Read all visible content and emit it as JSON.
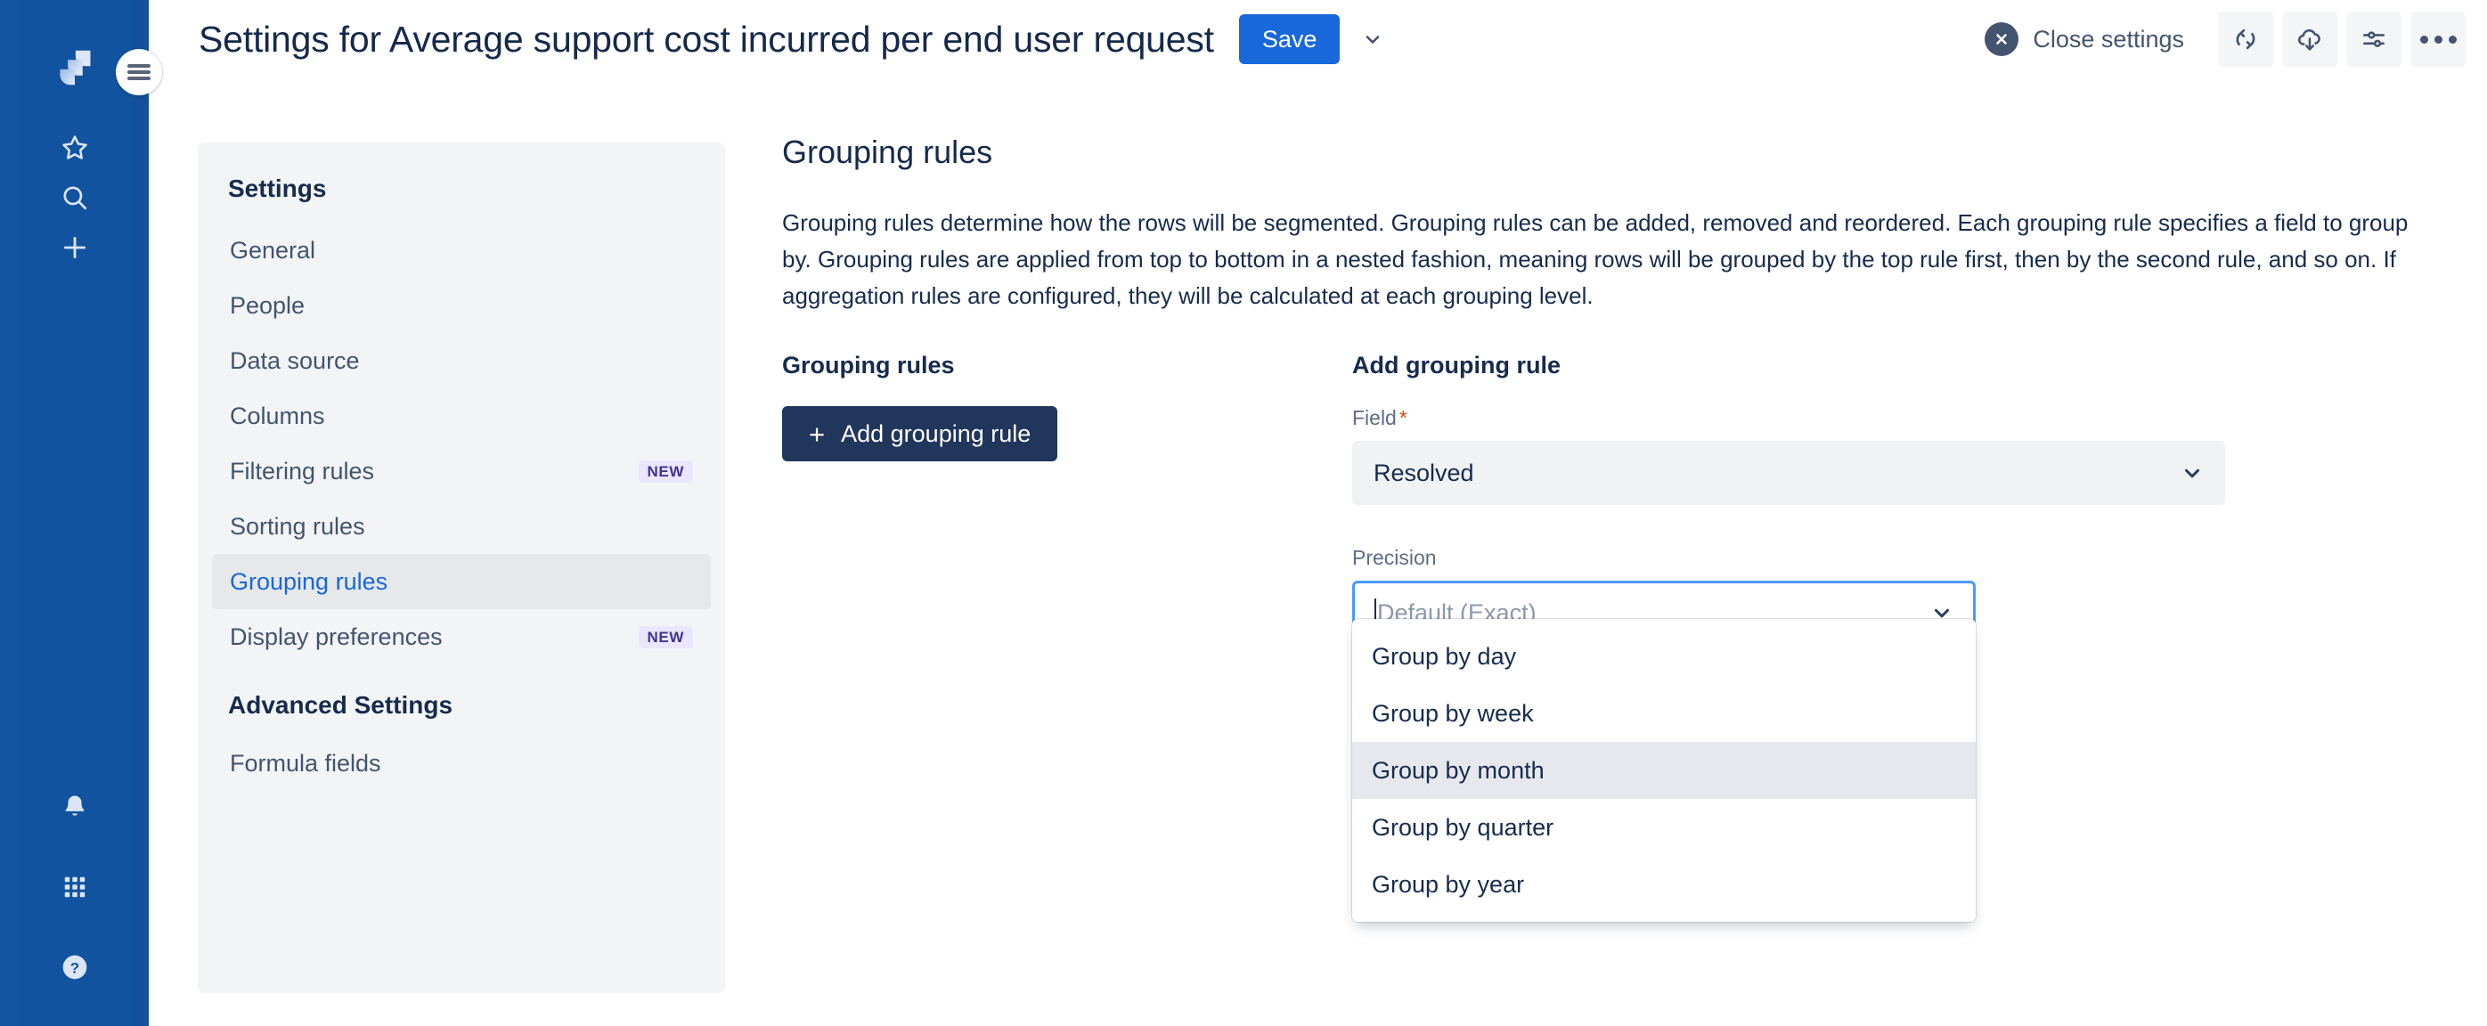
{
  "app_nav": {
    "logo_name": "jira-logo",
    "items": [
      {
        "name": "starred-icon",
        "label": "Starred"
      },
      {
        "name": "search-icon",
        "label": "Search"
      },
      {
        "name": "create-icon",
        "label": "Create"
      }
    ],
    "bottom_items": [
      {
        "name": "notifications-bell-icon",
        "label": "Notifications"
      },
      {
        "name": "app-switcher-icon",
        "label": "App switcher"
      },
      {
        "name": "help-icon",
        "label": "Help"
      }
    ]
  },
  "header": {
    "menu_toggle_name": "hamburger-menu",
    "title": "Settings for Average support cost incurred per end user request",
    "save_label": "Save",
    "save_caret_name": "save-options-chevron",
    "close_settings_label": "Close settings",
    "actions": [
      {
        "name": "sync-icon",
        "label": "Sync"
      },
      {
        "name": "cloud-download-icon",
        "label": "Export"
      },
      {
        "name": "sliders-icon",
        "label": "Configure"
      },
      {
        "name": "more-actions-icon",
        "label": "More actions"
      }
    ]
  },
  "settings_panel": {
    "heading": "Settings",
    "items": [
      {
        "label": "General",
        "badge": "",
        "active": false
      },
      {
        "label": "People",
        "badge": "",
        "active": false
      },
      {
        "label": "Data source",
        "badge": "",
        "active": false
      },
      {
        "label": "Columns",
        "badge": "",
        "active": false
      },
      {
        "label": "Filtering rules",
        "badge": "NEW",
        "active": false
      },
      {
        "label": "Sorting rules",
        "badge": "",
        "active": false
      },
      {
        "label": "Grouping rules",
        "badge": "",
        "active": true
      },
      {
        "label": "Display preferences",
        "badge": "NEW",
        "active": false
      }
    ],
    "advanced_heading": "Advanced Settings",
    "advanced_items": [
      {
        "label": "Formula fields",
        "badge": "",
        "active": false
      }
    ]
  },
  "main": {
    "title": "Grouping rules",
    "description": "Grouping rules determine how the rows will be segmented. Grouping rules can be added, removed and reordered. Each grouping rule specifies a field to group by. Grouping rules are applied from top to bottom in a nested fashion, meaning rows will be grouped by the top rule first, then by the second rule, and so on. If aggregation rules are configured, they will be calculated at each grouping level.",
    "left_column": {
      "title": "Grouping rules",
      "add_button_label": "Add grouping rule",
      "add_button_icon": "plus-icon"
    },
    "right_column": {
      "title": "Add grouping rule",
      "field": {
        "label": "Field",
        "required_marker": "*",
        "value": "Resolved",
        "chevron_name": "chevron-down-icon"
      },
      "precision": {
        "label": "Precision",
        "placeholder": "Default (Exact)",
        "value": "",
        "chevron_name": "chevron-down-icon",
        "options": [
          {
            "label": "Group by day",
            "hovered": false
          },
          {
            "label": "Group by week",
            "hovered": false
          },
          {
            "label": "Group by month",
            "hovered": true
          },
          {
            "label": "Group by quarter",
            "hovered": false
          },
          {
            "label": "Group by year",
            "hovered": false
          }
        ]
      }
    }
  },
  "colors": {
    "nav_blue": "#1253a0",
    "primary_blue": "#1868db",
    "dark_navy": "#20365b",
    "text_navy": "#172b4d",
    "subtle_text": "#5e6c84",
    "panel_bg": "#f3f4f6",
    "focus_border": "#4c9aff",
    "badge_bg": "#eae6ff",
    "badge_text": "#403294",
    "required_red": "#d9480f"
  }
}
